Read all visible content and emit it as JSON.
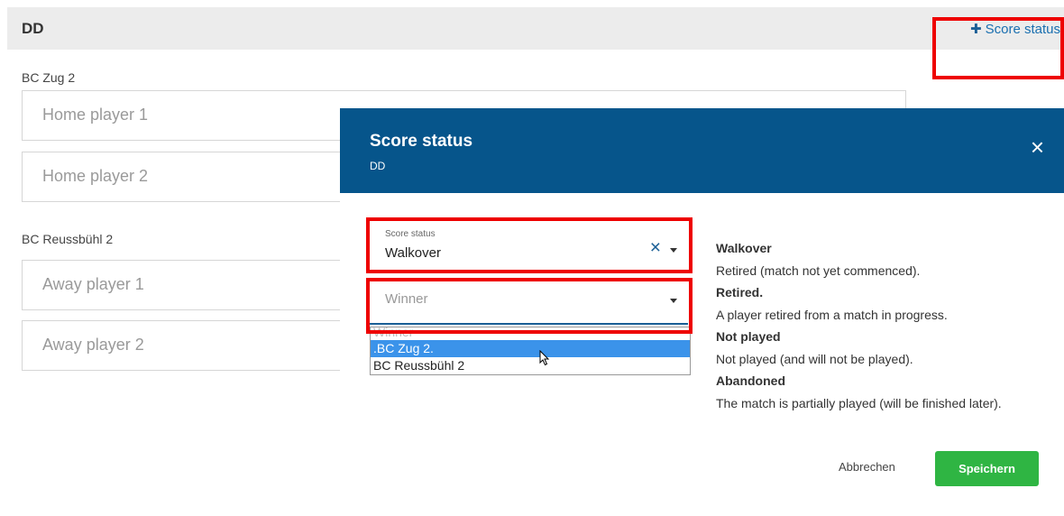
{
  "match": {
    "discipline": "DD",
    "add_label": "Score status",
    "home_team": "BC Zug 2",
    "home_player1_ph": "Home player 1",
    "home_player2_ph": "Home player 2",
    "away_team": "BC Reussbühl 2",
    "away_player1_ph": "Away player 1",
    "away_player2_ph": "Away player 2"
  },
  "modal": {
    "title": "Score status",
    "subtitle": "DD",
    "close_icon": "×",
    "status_field": {
      "label": "Score status",
      "value": "Walkover",
      "clear_icon": "×"
    },
    "winner_field": {
      "placeholder": "Winner"
    },
    "winner_options": [
      ".BC Zug 2.",
      "BC Reussbühl 2"
    ],
    "winner_ghost_option": "Winner",
    "descriptions": [
      {
        "title": "Walkover",
        "text": "Retired (match not yet commenced)."
      },
      {
        "title": "Retired.",
        "text": "A player retired from a match in progress."
      },
      {
        "title": "Not played",
        "text": "Not played (and will not be played)."
      },
      {
        "title": "Abandoned",
        "text": "The match is partially played (will be finished later)."
      }
    ],
    "cancel_label": "Abbrechen",
    "save_label": "Speichern"
  },
  "colors": {
    "header": "#06558b",
    "save": "#2fb543",
    "highlight": "#3b93ea",
    "annotation": "#ee0000"
  }
}
